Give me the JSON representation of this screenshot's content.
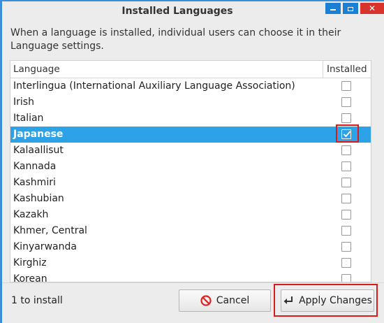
{
  "window": {
    "title": "Installed Languages",
    "description": "When a language is installed, individual users can choose it in their Language settings."
  },
  "list": {
    "header_language": "Language",
    "header_installed": "Installed",
    "rows": [
      {
        "name": "Interlingua (International Auxiliary Language Association)",
        "installed": false
      },
      {
        "name": "Irish",
        "installed": false
      },
      {
        "name": "Italian",
        "installed": false
      },
      {
        "name": "Japanese",
        "installed": true,
        "selected": true
      },
      {
        "name": "Kalaallisut",
        "installed": false
      },
      {
        "name": "Kannada",
        "installed": false
      },
      {
        "name": "Kashmiri",
        "installed": false
      },
      {
        "name": "Kashubian",
        "installed": false
      },
      {
        "name": "Kazakh",
        "installed": false
      },
      {
        "name": "Khmer, Central",
        "installed": false
      },
      {
        "name": "Kinyarwanda",
        "installed": false
      },
      {
        "name": "Kirghiz",
        "installed": false
      },
      {
        "name": "Korean",
        "installed": false
      }
    ]
  },
  "footer": {
    "status": "1 to install",
    "cancel_label": "Cancel",
    "apply_label": "Apply Changes"
  },
  "colors": {
    "selection": "#2ea2e6",
    "annotation": "#d81c1c",
    "titlebar_close": "#d9342b"
  }
}
